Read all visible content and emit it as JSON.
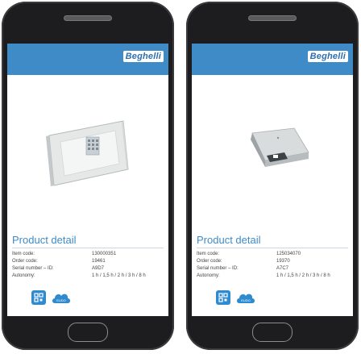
{
  "brand": "Beghelli",
  "colors": {
    "header": "#3f8bc7",
    "title": "#3f8bc7",
    "icon": "#2f8bd0",
    "phone": "#1d1d1f"
  },
  "icons": [
    "qr-code-icon",
    "cloud-icon"
  ],
  "cloud_icon_text": "EUDO",
  "screens": [
    {
      "detail_title": "Product detail",
      "rows": [
        {
          "label": "Item code:",
          "value": "130000351"
        },
        {
          "label": "Order code:",
          "value": "19461"
        },
        {
          "label": "Serial number – ID:",
          "value": "A9D7"
        },
        {
          "label": "Autonomy:",
          "value": "1 h / 1,5 h / 2 h / 3 h / 8 h"
        }
      ]
    },
    {
      "detail_title": "Product detail",
      "rows": [
        {
          "label": "Item code:",
          "value": "125034070"
        },
        {
          "label": "Order code:",
          "value": "19370"
        },
        {
          "label": "Serial number – ID:",
          "value": "A7C7"
        },
        {
          "label": "Autonomy:",
          "value": "1 h / 1,5 h / 2 h / 3 h / 8 h"
        }
      ]
    }
  ]
}
